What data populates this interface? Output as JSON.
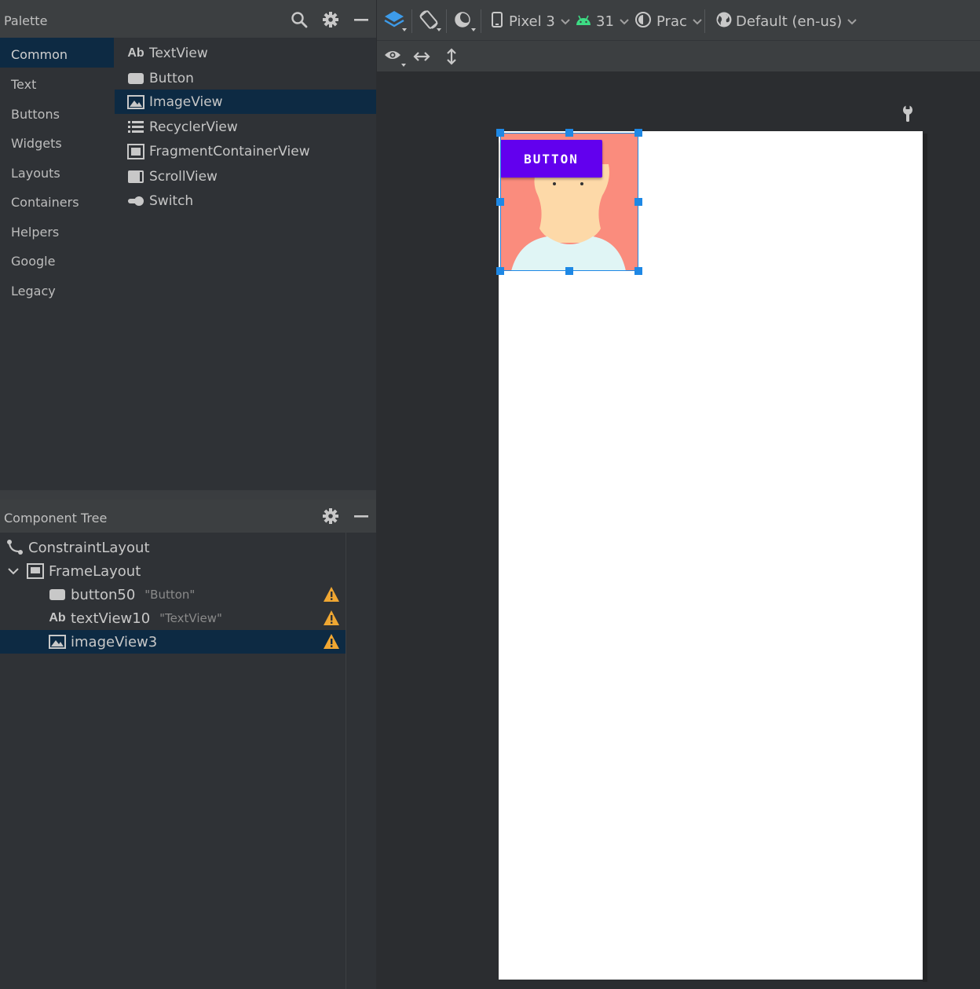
{
  "palette": {
    "title": "Palette",
    "categories": [
      {
        "label": "Common",
        "selected": true
      },
      {
        "label": "Text"
      },
      {
        "label": "Buttons"
      },
      {
        "label": "Widgets"
      },
      {
        "label": "Layouts"
      },
      {
        "label": "Containers"
      },
      {
        "label": "Helpers"
      },
      {
        "label": "Google"
      },
      {
        "label": "Legacy"
      }
    ],
    "items": [
      {
        "label": "TextView",
        "icon": "textview-icon",
        "icon_text": "Ab"
      },
      {
        "label": "Button",
        "icon": "button-icon"
      },
      {
        "label": "ImageView",
        "icon": "image-icon",
        "selected": true
      },
      {
        "label": "RecyclerView",
        "icon": "list-icon"
      },
      {
        "label": "FragmentContainerView",
        "icon": "fragment-icon"
      },
      {
        "label": "ScrollView",
        "icon": "scrollview-icon"
      },
      {
        "label": "Switch",
        "icon": "switch-icon"
      }
    ]
  },
  "component_tree": {
    "title": "Component Tree",
    "nodes": [
      {
        "label": "ConstraintLayout",
        "icon": "constraint-icon"
      },
      {
        "label": "FrameLayout",
        "icon": "framelayout-icon",
        "expanded": true
      },
      {
        "label": "button50",
        "sub": "\"Button\"",
        "icon": "button-icon",
        "warning": true
      },
      {
        "label": "textView10",
        "sub": "\"TextView\"",
        "icon": "textview-icon",
        "icon_text": "Ab",
        "warning": true
      },
      {
        "label": "imageView3",
        "icon": "image-icon",
        "warning": true,
        "selected": true
      }
    ]
  },
  "toolbar": {
    "device": "Pixel 3",
    "api": "31",
    "theme": "Prac",
    "locale": "Default (en-us)"
  },
  "preview": {
    "button_label": "BUTTON"
  },
  "colors": {
    "accent": "#1e88e5",
    "button": "#6200ee",
    "image_bg": "#fa8c7d",
    "selection": "#0d2a43",
    "warning": "#f0a732",
    "android_green": "#3ddc84"
  }
}
